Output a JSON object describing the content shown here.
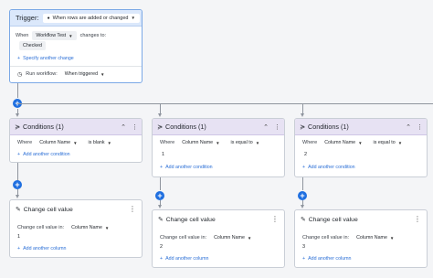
{
  "trigger": {
    "label": "Trigger:",
    "event": "When rows are added or changed",
    "when_label": "When",
    "column": "Workflow Test",
    "changes_to_label": "changes to:",
    "value_chip": "Checked",
    "specify_link": "Specify another change",
    "run_label": "Run workflow:",
    "run_value": "When triggered"
  },
  "conditions": [
    {
      "title": "Conditions (1)",
      "where_label": "Where",
      "column": "Column Name",
      "operator": "is blank",
      "value": "",
      "add_link": "Add another condition"
    },
    {
      "title": "Conditions (1)",
      "where_label": "Where",
      "column": "Column Name",
      "operator": "is equal to",
      "value": "1",
      "add_link": "Add another condition"
    },
    {
      "title": "Conditions (1)",
      "where_label": "Where",
      "column": "Column Name",
      "operator": "is equal to",
      "value": "2",
      "add_link": "Add another condition"
    }
  ],
  "actions": [
    {
      "title": "Change cell value",
      "field_label": "Change cell value in:",
      "column": "Column Name",
      "value": "1",
      "add_link": "Add another column"
    },
    {
      "title": "Change cell value",
      "field_label": "Change cell value in:",
      "column": "Column Name",
      "value": "2",
      "add_link": "Add another column"
    },
    {
      "title": "Change cell value",
      "field_label": "Change cell value in:",
      "column": "Column Name",
      "value": "3",
      "add_link": "Add another column"
    }
  ],
  "icons": {
    "collapse": "chevron-up-icon",
    "more": "more-vertical-icon",
    "filter": "filter-icon",
    "edit": "pencil-icon",
    "add": "plus-icon"
  },
  "colors": {
    "trigger_header": "#dbe8fb",
    "condition_header": "#e7e2f3",
    "accent": "#1f6fe0",
    "link": "#2b6fd6"
  }
}
